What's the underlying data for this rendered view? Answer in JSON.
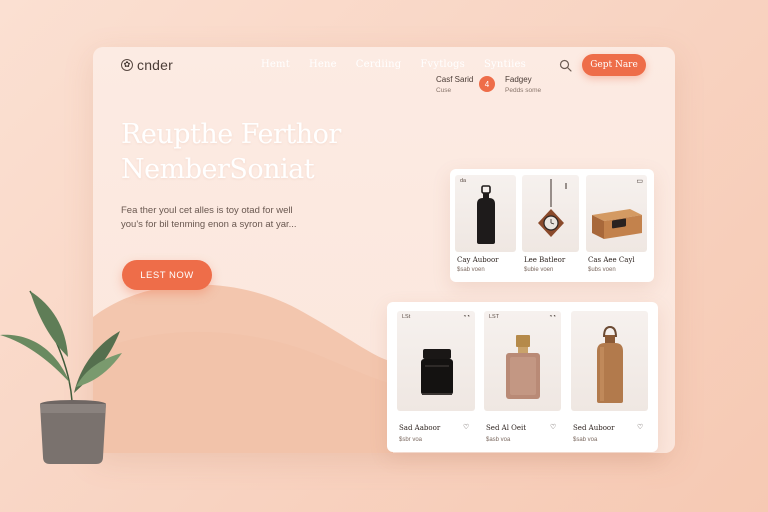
{
  "brand": {
    "name": "cnder",
    "logo_icon": "circle-logo-icon"
  },
  "nav": {
    "links": [
      "Hemt",
      "Hene",
      "Cerdiing",
      "Fvytlogs",
      "Syntiies"
    ],
    "search_icon": "search-icon",
    "cta_label": "Gept Nare"
  },
  "hero": {
    "title_line1": "Reupthe Ferthor",
    "title_line2": "NemberSoniat",
    "subtitle_line1": "Fea ther youl cet alles is toy otad for well",
    "subtitle_line2": "you's for bil tenming enon a syron at yar...",
    "button_label": "LEST NOW"
  },
  "meta": {
    "left_title": "Casf Sarid",
    "left_sub": "Cuse",
    "badge_text": "4",
    "right_title": "Fadgey",
    "right_sub": "Pedds some"
  },
  "featured": [
    {
      "name": "Cay Auboor",
      "sub": "$sab voen",
      "tag": "da",
      "heart": "♡"
    },
    {
      "name": "Lee Batleor",
      "sub": "$ubie voen",
      "tag": "",
      "heart": ""
    },
    {
      "name": "Cas Aee Cayl",
      "sub": "$ubs voen",
      "tag": "",
      "heart": ""
    }
  ],
  "products": [
    {
      "name": "Sad Aaboor",
      "sub": "$sbr voa",
      "tag": "LSt",
      "heart": "♡"
    },
    {
      "name": "Sed Al Oeit",
      "sub": "$asb voa",
      "tag": "LST",
      "heart": "♡"
    },
    {
      "name": "Sed Auboor",
      "sub": "$sab voa",
      "tag": "",
      "heart": "♡"
    }
  ],
  "colors": {
    "accent": "#ee6d49",
    "background": "#f8d3c1",
    "card": "#fce9e0",
    "hill": "#f3c8b0"
  }
}
